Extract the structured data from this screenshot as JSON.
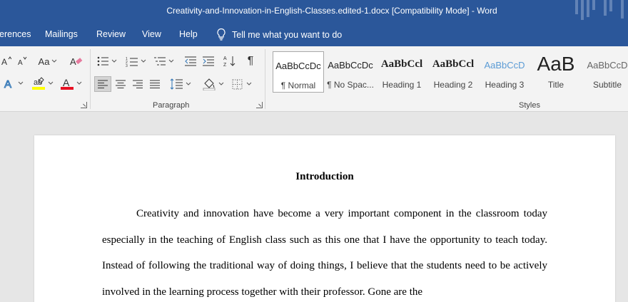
{
  "window": {
    "title": "Creativity-and-Innovation-in-English-Classes.edited-1.docx [Compatibility Mode]  -  Word"
  },
  "menu": {
    "items": [
      "erences",
      "Mailings",
      "Review",
      "View",
      "Help"
    ],
    "tell_me": "Tell me what you want to do"
  },
  "ribbon": {
    "groups": {
      "paragraph": "Paragraph",
      "styles": "Styles"
    },
    "font_case_label": "Aa",
    "styles": [
      {
        "sample": "AaBbCcDc",
        "name": "¶ Normal"
      },
      {
        "sample": "AaBbCcDc",
        "name": "¶ No Spac..."
      },
      {
        "sample": "AaBbCcl",
        "name": "Heading 1"
      },
      {
        "sample": "AaBbCcl",
        "name": "Heading 2"
      },
      {
        "sample": "AaBbCcD",
        "name": "Heading 3"
      },
      {
        "sample": "AaB",
        "name": "Title"
      },
      {
        "sample": "AaBbCcD",
        "name": "Subtitle"
      }
    ]
  },
  "document": {
    "heading": "Introduction",
    "paragraph": "Creativity and innovation have become a very important component in the classroom today especially in the teaching of English class such as this one that I have the opportunity to teach today. Instead of following the traditional way of doing things, I believe that the students need to be actively involved in the learning process together with their professor. Gone are the"
  },
  "colors": {
    "title_bar": "#2b579a",
    "ribbon": "#f3f3f3",
    "canvas": "#e6e6e6",
    "highlight": "#ffff00",
    "font_color": "#e81123",
    "heading_style": "#2e74b5"
  }
}
